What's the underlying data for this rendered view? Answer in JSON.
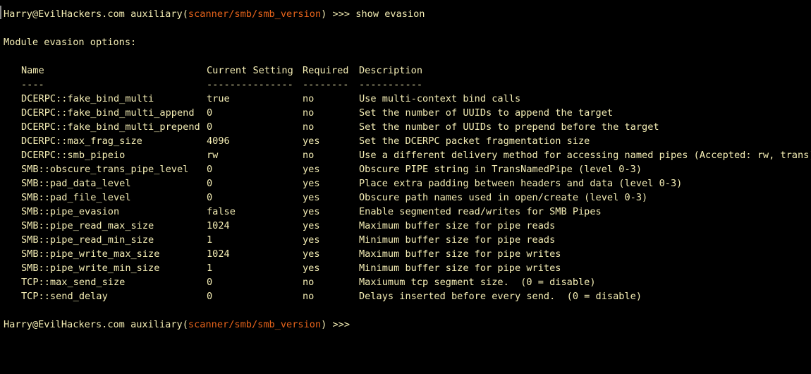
{
  "colors": {
    "background": "#000000",
    "text": "#f4edb4",
    "module_accent": "#e8641b"
  },
  "prompt": {
    "user_host": "Harry@EvilHackers.com",
    "module_type": "auxiliary",
    "open_paren": "(",
    "module_path": "scanner/smb/smb_version",
    "close_paren": ")",
    "symbol": " >>> ",
    "command": "show evasion"
  },
  "section_title": "Module evasion options:",
  "table": {
    "headers": {
      "name": "Name",
      "current_setting": "Current Setting",
      "required": "Required",
      "description": "Description"
    },
    "separators": {
      "name": "----",
      "current_setting": "---------------",
      "required": "--------",
      "description": "-----------"
    },
    "rows": [
      {
        "name": "DCERPC::fake_bind_multi",
        "setting": "true",
        "required": "no",
        "description": "Use multi-context bind calls"
      },
      {
        "name": "DCERPC::fake_bind_multi_append",
        "setting": "0",
        "required": "no",
        "description": "Set the number of UUIDs to append the target"
      },
      {
        "name": "DCERPC::fake_bind_multi_prepend",
        "setting": "0",
        "required": "no",
        "description": "Set the number of UUIDs to prepend before the target"
      },
      {
        "name": "DCERPC::max_frag_size",
        "setting": "4096",
        "required": "yes",
        "description": "Set the DCERPC packet fragmentation size"
      },
      {
        "name": "DCERPC::smb_pipeio",
        "setting": "rw",
        "required": "no",
        "description": "Use a different delivery method for accessing named pipes (Accepted: rw, trans)"
      },
      {
        "name": "SMB::obscure_trans_pipe_level",
        "setting": "0",
        "required": "yes",
        "description": "Obscure PIPE string in TransNamedPipe (level 0-3)"
      },
      {
        "name": "SMB::pad_data_level",
        "setting": "0",
        "required": "yes",
        "description": "Place extra padding between headers and data (level 0-3)"
      },
      {
        "name": "SMB::pad_file_level",
        "setting": "0",
        "required": "yes",
        "description": "Obscure path names used in open/create (level 0-3)"
      },
      {
        "name": "SMB::pipe_evasion",
        "setting": "false",
        "required": "yes",
        "description": "Enable segmented read/writes for SMB Pipes"
      },
      {
        "name": "SMB::pipe_read_max_size",
        "setting": "1024",
        "required": "yes",
        "description": "Maximum buffer size for pipe reads"
      },
      {
        "name": "SMB::pipe_read_min_size",
        "setting": "1",
        "required": "yes",
        "description": "Minimum buffer size for pipe reads"
      },
      {
        "name": "SMB::pipe_write_max_size",
        "setting": "1024",
        "required": "yes",
        "description": "Maximum buffer size for pipe writes"
      },
      {
        "name": "SMB::pipe_write_min_size",
        "setting": "1",
        "required": "yes",
        "description": "Minimum buffer size for pipe writes"
      },
      {
        "name": "TCP::max_send_size",
        "setting": "0",
        "required": "no",
        "description": "Maxiumum tcp segment size.  (0 = disable)"
      },
      {
        "name": "TCP::send_delay",
        "setting": "0",
        "required": "no",
        "description": "Delays inserted before every send.  (0 = disable)"
      }
    ]
  },
  "final_prompt": {
    "user_host": "Harry@EvilHackers.com",
    "module_type": "auxiliary",
    "open_paren": "(",
    "module_path": "scanner/smb/smb_version",
    "close_paren": ")",
    "symbol": " >>>"
  }
}
